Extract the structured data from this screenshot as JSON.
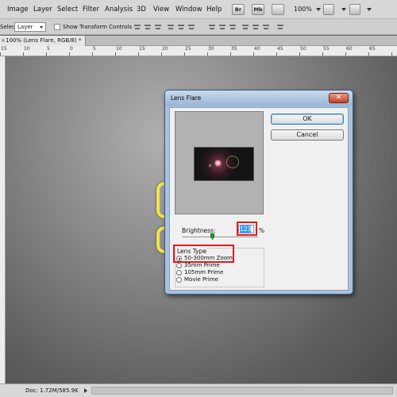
{
  "menubar": {
    "items": [
      "Image",
      "Layer",
      "Select",
      "Filter",
      "Analysis",
      "3D",
      "View",
      "Window",
      "Help"
    ],
    "bridge_btn": "Br",
    "minibridge_btn": "Mb",
    "zoom": "100%"
  },
  "options_bar": {
    "select_label": "Select:",
    "select_value": "Layer",
    "show_transform_label": "Show Transform Controls"
  },
  "document_tab": {
    "close": "×",
    "title": "100% (Lens Flare, RGB/8) *"
  },
  "ruler": {
    "ticks": [
      "15",
      "10",
      "5",
      "0",
      "5",
      "10",
      "15",
      "20",
      "25",
      "30",
      "35",
      "40",
      "45",
      "50",
      "55",
      "60",
      "65"
    ]
  },
  "status_bar": {
    "doc_info": "Doc: 1.72M/585.9K"
  },
  "dialog": {
    "title": "Lens Flare",
    "close": "✕",
    "ok_label": "OK",
    "cancel_label": "Cancel",
    "brightness_label": "Brightness:",
    "brightness_value": "123",
    "brightness_unit": "%",
    "brightness_level_percent": 123,
    "lens_type_label": "Lens Type",
    "lens_options": [
      "50-300mm Zoom",
      "35mm Prime",
      "105mm Prime",
      "Movie Prime"
    ],
    "selected_lens": "50-300mm Zoom"
  },
  "colors": {
    "highlight": "#e01b1b",
    "selection": "#3399ff",
    "glyph": "#f1e44a"
  }
}
